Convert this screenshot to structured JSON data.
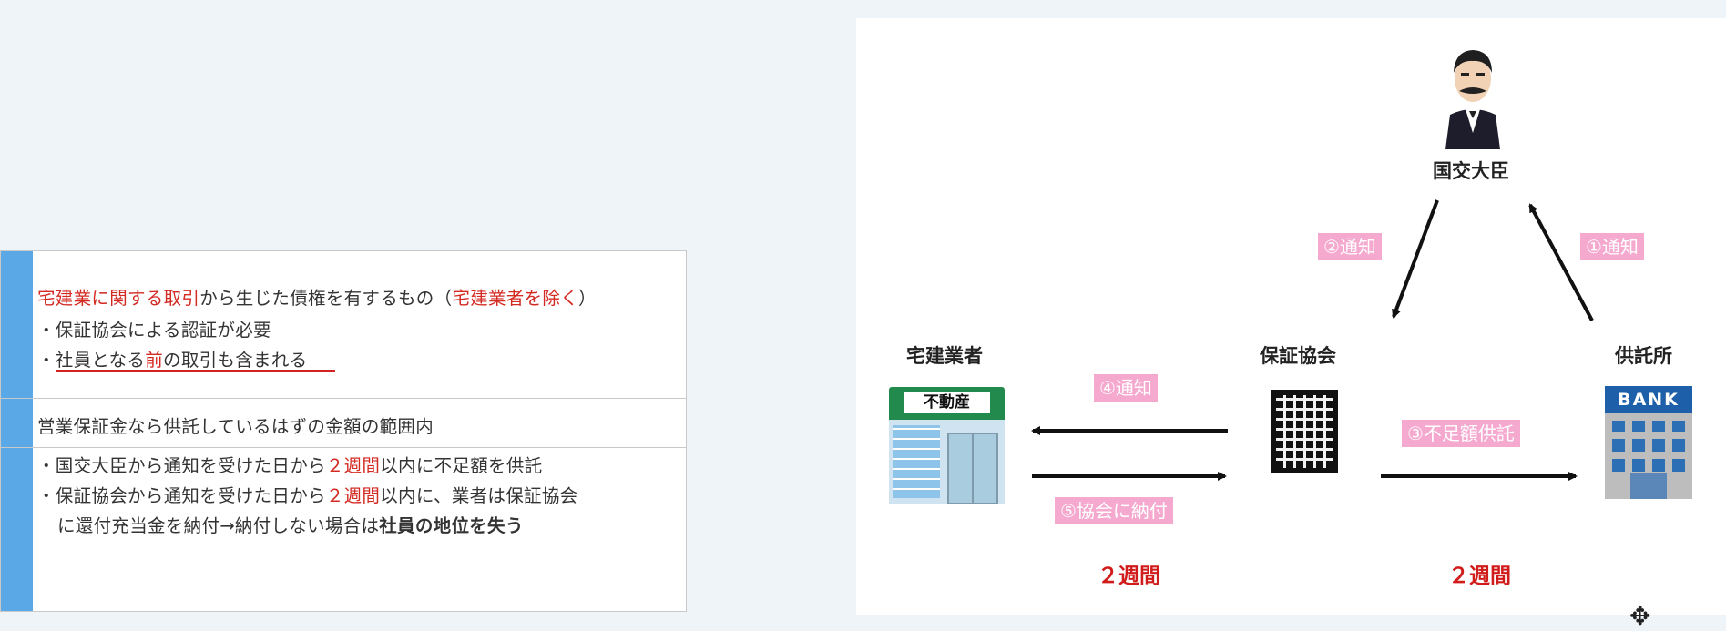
{
  "left_table": {
    "row1": {
      "line1_a": "宅建業に関する取引",
      "line1_b": "から生じた債権を有するもの（",
      "line1_c": "宅建業者を除く",
      "line1_d": "）",
      "line2": "・保証協会による認証が必要",
      "line3_a": "・社員となる",
      "line3_b": "前",
      "line3_c": "の取引も含まれる"
    },
    "row2": {
      "line1": "営業保証金なら供託しているはずの金額の範囲内"
    },
    "row3": {
      "line1_a": "・国交大臣から通知を受けた日から",
      "line1_b": "２週間",
      "line1_c": "以内に不足額を供託",
      "line2_a": "・保証協会から通知を受けた日から",
      "line2_b": "２週間",
      "line2_c": "以内に、業者は保証協会",
      "line3_a": "に還付充当金を納付→納付しない場合は",
      "line3_b": "社員の地位を失う"
    }
  },
  "diagram": {
    "nodes": {
      "minister": "国交大臣",
      "agent": "宅建業者",
      "association": "保証協会",
      "deposit_office": "供託所"
    },
    "store_sign": "不動産",
    "bank_sign": "BANK",
    "steps": {
      "s1": "①通知",
      "s2": "②通知",
      "s3": "③不足額供託",
      "s4": "④通知",
      "s5": "⑤協会に納付"
    },
    "deadline_left": "２週間",
    "deadline_right": "２週間"
  },
  "colors": {
    "accent_red": "#d32a22",
    "tag_pink": "#f5a9cf",
    "table_bar_blue": "#5aa8e6"
  },
  "cursor_icon": "move-cursor-icon"
}
